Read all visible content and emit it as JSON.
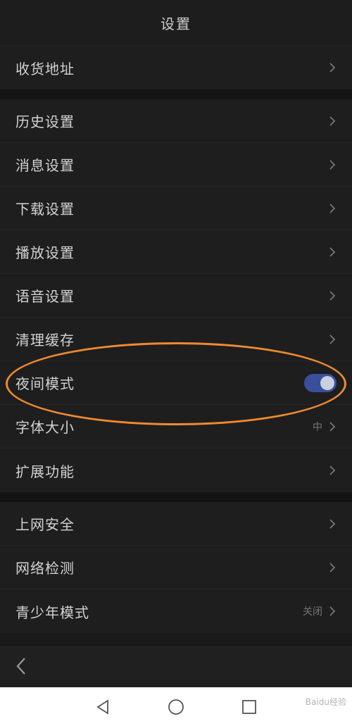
{
  "header": {
    "title": "设置"
  },
  "groups": [
    {
      "items": [
        {
          "label": "收货地址"
        }
      ]
    },
    {
      "items": [
        {
          "label": "历史设置"
        },
        {
          "label": "消息设置"
        },
        {
          "label": "下载设置"
        },
        {
          "label": "播放设置"
        },
        {
          "label": "语音设置"
        },
        {
          "label": "清理缓存"
        },
        {
          "label": "夜间模式",
          "toggle_on": true
        },
        {
          "label": "字体大小",
          "value": "中"
        },
        {
          "label": "扩展功能"
        }
      ]
    },
    {
      "items": [
        {
          "label": "上网安全"
        },
        {
          "label": "网络检测"
        },
        {
          "label": "青少年模式",
          "value": "关闭"
        }
      ]
    }
  ],
  "colors": {
    "accent_toggle": "#3a4f9a",
    "highlight_oval": "#ef8a30",
    "background": "#1a1a1a"
  },
  "bottom": {
    "back_icon": "chevron-left-icon"
  },
  "android_nav": {
    "icons": [
      "back-triangle-icon",
      "home-circle-icon",
      "recents-square-icon"
    ]
  },
  "watermark": "Baidu经验"
}
